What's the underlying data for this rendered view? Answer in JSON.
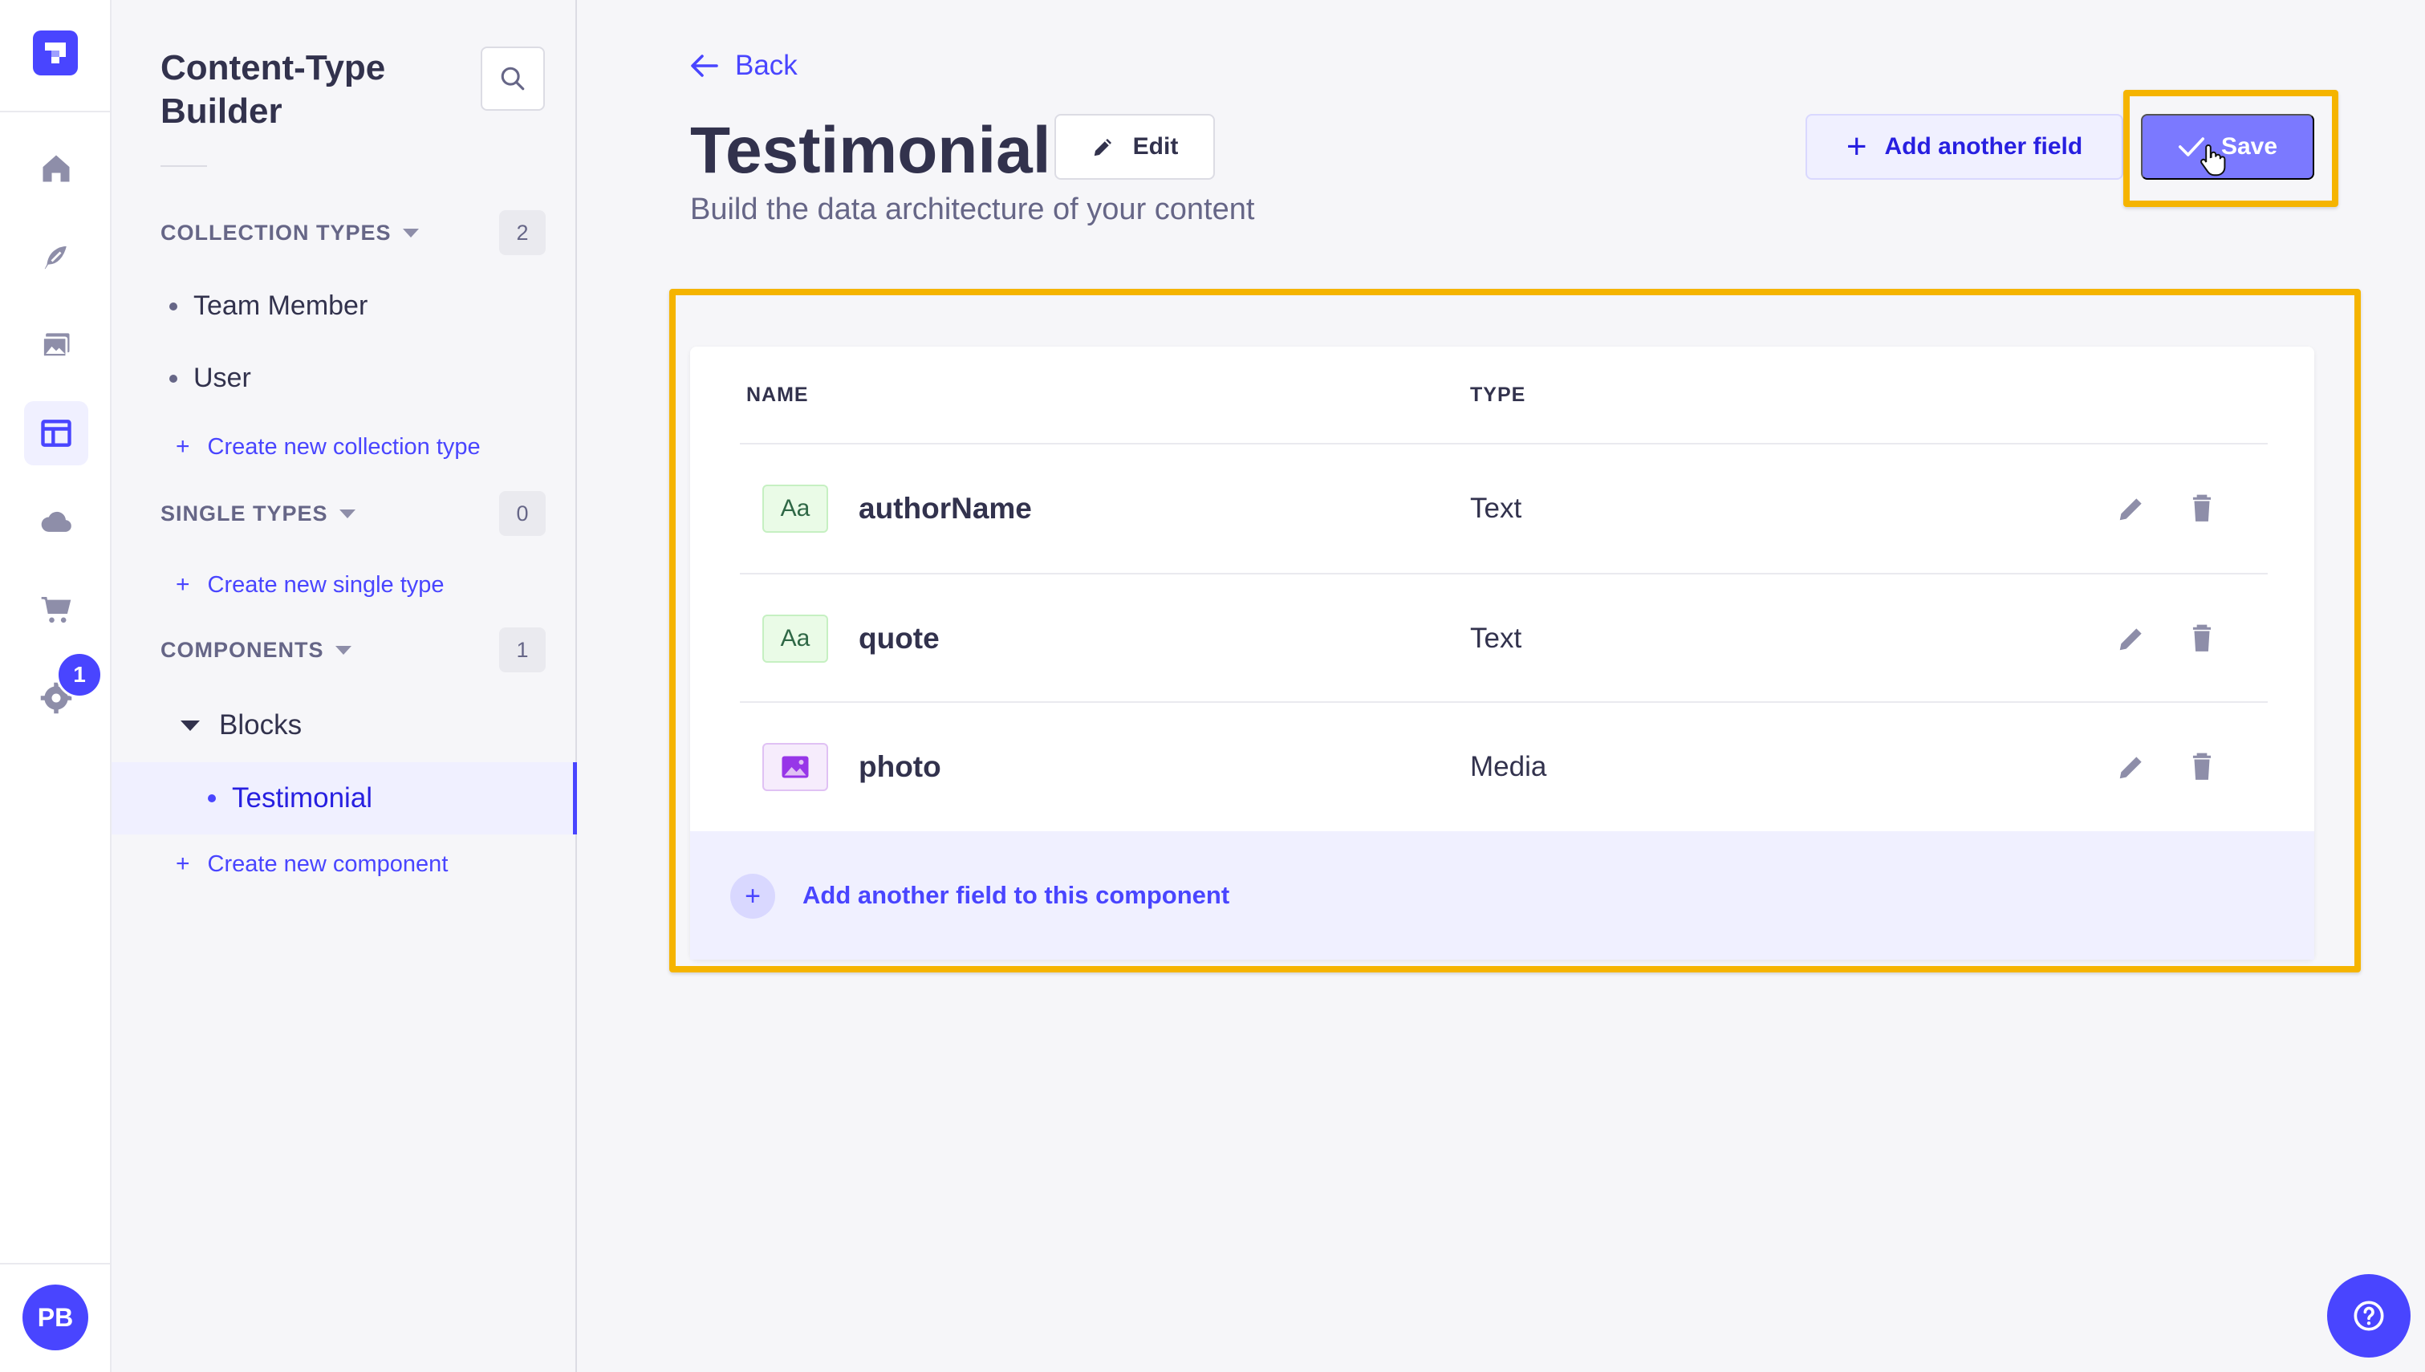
{
  "rail": {
    "badge_count": "1",
    "avatar_initials": "PB",
    "items": [
      "home-icon",
      "feather-icon",
      "media-library-icon",
      "content-type-builder-icon",
      "cloud-icon",
      "cart-icon",
      "settings-icon"
    ]
  },
  "subnav": {
    "title": "Content-Type Builder",
    "collection_types": {
      "label": "COLLECTION TYPES",
      "count": "2",
      "items": [
        "Team Member",
        "User"
      ],
      "create_label": "Create new collection type"
    },
    "single_types": {
      "label": "SINGLE TYPES",
      "count": "0",
      "create_label": "Create new single type"
    },
    "components": {
      "label": "COMPONENTS",
      "count": "1",
      "group": "Blocks",
      "items": [
        "Testimonial"
      ],
      "create_label": "Create new component"
    }
  },
  "header": {
    "back_label": "Back",
    "title": "Testimonial",
    "edit_label": "Edit",
    "subtitle": "Build the data architecture of your content",
    "add_field_label": "Add another field",
    "save_label": "Save"
  },
  "table": {
    "columns": [
      "NAME",
      "TYPE"
    ],
    "rows": [
      {
        "icon_text": "Aa",
        "icon": "text-field-icon",
        "name": "authorName",
        "type": "Text"
      },
      {
        "icon_text": "Aa",
        "icon": "text-field-icon",
        "name": "quote",
        "type": "Text"
      },
      {
        "icon_text": "",
        "icon": "media-field-icon",
        "name": "photo",
        "type": "Media"
      }
    ],
    "add_field_label": "Add another field to this component"
  },
  "colors": {
    "primary": "#4945ff",
    "highlight": "#f5b400",
    "save_button": "#7b79ff"
  }
}
